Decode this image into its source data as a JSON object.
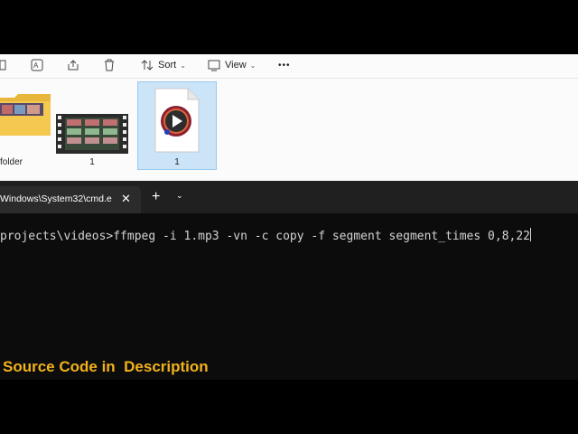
{
  "explorer": {
    "toolbar": {
      "sort_label": "Sort",
      "view_label": "View",
      "more_label": "•••"
    },
    "files": [
      {
        "name": "w folder"
      },
      {
        "name": "1"
      },
      {
        "name": "1"
      }
    ]
  },
  "terminal": {
    "tab_title": "Windows\\System32\\cmd.e",
    "tab_close": "✕",
    "new_tab": "+",
    "dropdown": "⌄",
    "command_line": "projects\\videos>ffmpeg -i 1.mp3 -vn -c copy -f segment segment_times 0,8,22",
    "caption": "Source Code in  Description"
  },
  "colors": {
    "caption": "#f2b21a",
    "selection": "#cce4f7",
    "terminal_bg": "#0c0c0c"
  }
}
